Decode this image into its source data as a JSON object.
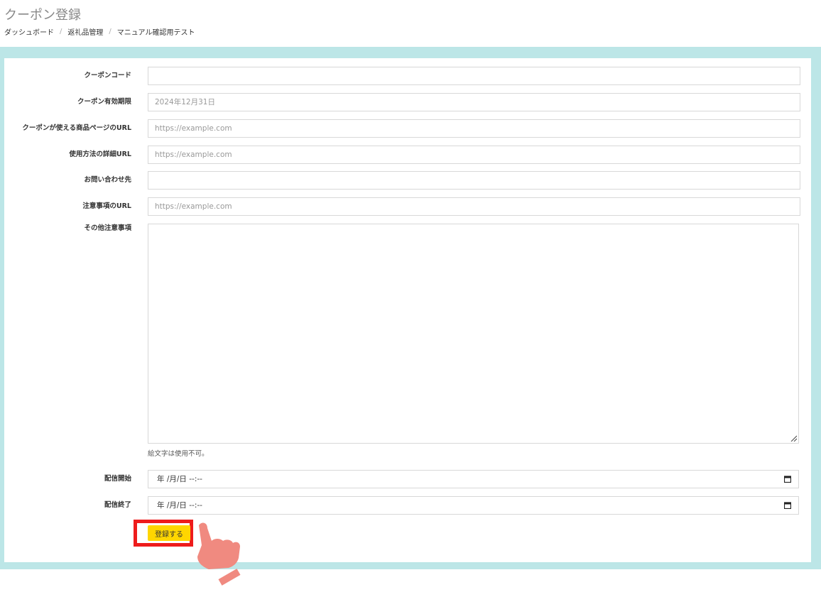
{
  "page": {
    "title": "クーポン登録",
    "breadcrumb": [
      "ダッシュボード",
      "返礼品管理",
      "マニュアル確認用テスト"
    ]
  },
  "form": {
    "fields": [
      {
        "label": "クーポンコード",
        "value": ""
      },
      {
        "label": "クーポン有効期限",
        "placeholder": "2024年12月31日"
      },
      {
        "label": "クーポンが使える商品ページのURL",
        "placeholder": "https://example.com"
      },
      {
        "label": "使用方法の詳細URL",
        "placeholder": "https://example.com"
      },
      {
        "label": "お問い合わせ先",
        "value": ""
      },
      {
        "label": "注意事項のURL",
        "placeholder": "https://example.com"
      }
    ],
    "notes": {
      "label": "その他注意事項",
      "help": "絵文字は使用不可。"
    },
    "start": {
      "label": "配信開始",
      "placeholder": "年 /月/日 --:--"
    },
    "end": {
      "label": "配信終了",
      "placeholder": "年 /月/日 --:--"
    },
    "submit_label": "登録する"
  },
  "colors": {
    "frame": "#bce6e7",
    "button": "#ffd600",
    "highlight": "#ee1c1c",
    "hand": "#f08a80"
  },
  "icons": {
    "calendar": "calendar-icon",
    "resize": "resize-handle-icon",
    "pointer": "pointing-hand-icon"
  }
}
